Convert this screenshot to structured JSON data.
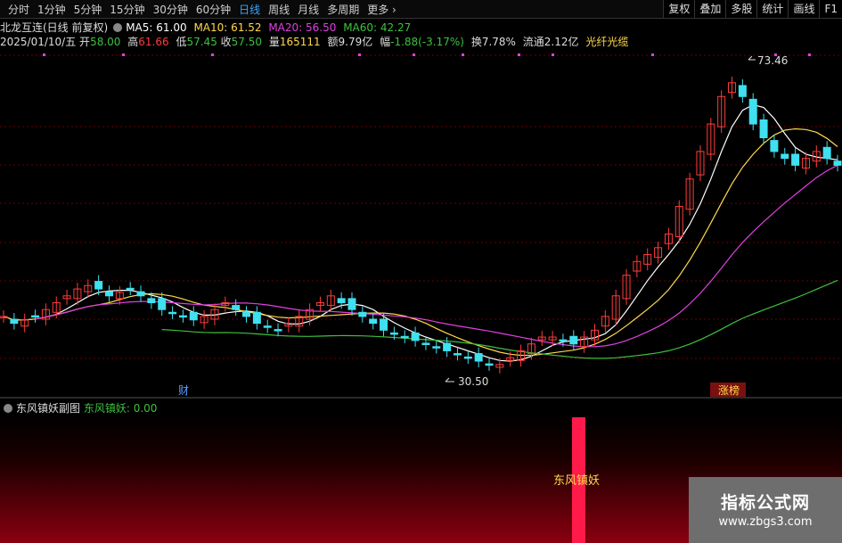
{
  "toolbar": {
    "periods": [
      {
        "label": "分时"
      },
      {
        "label": "1分钟"
      },
      {
        "label": "5分钟"
      },
      {
        "label": "15分钟"
      },
      {
        "label": "30分钟"
      },
      {
        "label": "60分钟"
      },
      {
        "label": "日线"
      },
      {
        "label": "周线"
      },
      {
        "label": "月线"
      },
      {
        "label": "多周期"
      },
      {
        "label": "更多"
      }
    ],
    "active_period": "日线",
    "tools": [
      "复权",
      "叠加",
      "多股",
      "统计",
      "画线",
      "F1"
    ]
  },
  "header": {
    "stock_title": "北龙互连(日线 前复权)",
    "ma5": "MA5: 61.00",
    "ma10": "MA10: 61.52",
    "ma20": "MA20: 56.50",
    "ma60": "MA60: 42.27",
    "date": "2025/01/10/五",
    "open_label": "开",
    "open": "58.00",
    "high_label": "高",
    "high": "61.66",
    "low_label": "低",
    "low": "57.45",
    "close_label": "收",
    "close": "57.50",
    "vol_label": "量",
    "vol": "165111",
    "amount_label": "额",
    "amount": "9.79亿",
    "change_label": "幅",
    "change": "-1.88(-3.17%)",
    "turnover_label": "换",
    "turnover": "7.78%",
    "float_label": "流通",
    "float": "2.12亿",
    "concept": "光纤光缆"
  },
  "chart_annotations": {
    "high_label": "73.46",
    "low_label": "30.50",
    "tag_cai": "财",
    "tag_zhangbang": "涨榜"
  },
  "sub_panel": {
    "title": "东风镇妖副图",
    "indicator": "东风镇妖: 0.00",
    "signal_label": "东风镇妖"
  },
  "watermark": {
    "line1": "指标公式网",
    "line2": "www.zbgs3.com"
  },
  "colors": {
    "up": "#ff3c3c",
    "down": "#3fe0f0",
    "ma5": "#ffffff",
    "ma10": "#ffd94a",
    "ma20": "#e040e0",
    "ma60": "#3ec03e",
    "grid": "#6a0000"
  },
  "chart_data": {
    "type": "candlestick",
    "x": [
      "2025/01/10"
    ],
    "series": [
      {
        "name": "MA5",
        "values": [
          61.0
        ]
      },
      {
        "name": "MA10",
        "values": [
          61.52
        ]
      },
      {
        "name": "MA20",
        "values": [
          56.5
        ]
      },
      {
        "name": "MA60",
        "values": [
          42.27
        ]
      }
    ],
    "candles": [
      {
        "date": "2025/01/10",
        "open": 58.0,
        "high": 61.66,
        "low": 57.45,
        "close": 57.5
      }
    ],
    "range_high": 73.46,
    "range_low": 30.5,
    "indicator": {
      "name": "东风镇妖",
      "value": 0.0
    }
  }
}
